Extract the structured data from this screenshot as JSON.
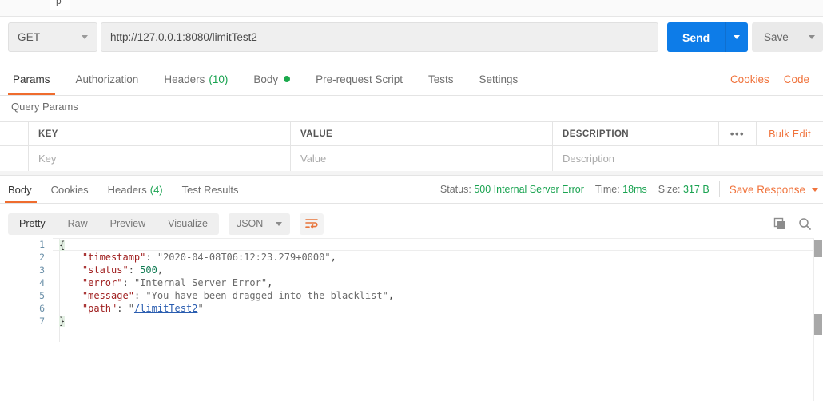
{
  "tabstrip": {
    "partial_tab_label": "p",
    "caret_icon": "chevron-down-icon"
  },
  "request": {
    "method": "GET",
    "url": "http://127.0.0.1:8080/limitTest2",
    "send_label": "Send",
    "save_label": "Save",
    "tabs": [
      {
        "label": "Params",
        "active": true,
        "count": "",
        "dot": false
      },
      {
        "label": "Authorization",
        "active": false,
        "count": "",
        "dot": false
      },
      {
        "label": "Headers",
        "active": false,
        "count": "(10)",
        "dot": false
      },
      {
        "label": "Body",
        "active": false,
        "count": "",
        "dot": true
      },
      {
        "label": "Pre-request Script",
        "active": false,
        "count": "",
        "dot": false
      },
      {
        "label": "Tests",
        "active": false,
        "count": "",
        "dot": false
      },
      {
        "label": "Settings",
        "active": false,
        "count": "",
        "dot": false
      }
    ],
    "cookies_link": "Cookies",
    "code_link": "Code"
  },
  "query_params": {
    "title": "Query Params",
    "headers": {
      "key": "KEY",
      "value": "VALUE",
      "description": "DESCRIPTION"
    },
    "placeholders": {
      "key": "Key",
      "value": "Value",
      "description": "Description"
    },
    "more_dots": "•••",
    "bulk_edit": "Bulk Edit"
  },
  "response": {
    "tabs": [
      {
        "label": "Body",
        "active": true,
        "count": ""
      },
      {
        "label": "Cookies",
        "active": false,
        "count": ""
      },
      {
        "label": "Headers",
        "active": false,
        "count": "(4)"
      },
      {
        "label": "Test Results",
        "active": false,
        "count": ""
      }
    ],
    "status_label": "Status:",
    "status_value": "500 Internal Server Error",
    "time_label": "Time:",
    "time_value": "18ms",
    "size_label": "Size:",
    "size_value": "317 B",
    "save_response": "Save Response",
    "format_modes": [
      {
        "label": "Pretty",
        "active": true
      },
      {
        "label": "Raw",
        "active": false
      },
      {
        "label": "Preview",
        "active": false
      },
      {
        "label": "Visualize",
        "active": false
      }
    ],
    "language": "JSON",
    "wrap_icon": "word-wrap-icon",
    "copy_icon": "copy-icon",
    "search_icon": "search-icon"
  },
  "body": {
    "line_numbers": [
      "1",
      "2",
      "3",
      "4",
      "5",
      "6",
      "7"
    ],
    "json": {
      "timestamp": "2020-04-08T06:12:23.279+0000",
      "status": 500,
      "error": "Internal Server Error",
      "message": "You have been dragged into the blacklist",
      "path": "/limitTest2"
    },
    "keys": {
      "timestamp": "\"timestamp\"",
      "status": "\"status\"",
      "error": "\"error\"",
      "message": "\"message\"",
      "path": "\"path\""
    },
    "values": {
      "timestamp": "\"2020-04-08T06:12:23.279+0000\"",
      "status": "500",
      "error": "\"Internal Server Error\"",
      "message": "\"You have been dragged into the blacklist\"",
      "path": "/limitTest2"
    },
    "open_brace": "{",
    "close_brace": "}"
  },
  "colors": {
    "accent_orange": "#ef6c2e",
    "send_blue": "#0d7ce8",
    "status_green": "#1aa351",
    "json_key": "#a02020",
    "json_number": "#0f7a52",
    "json_link": "#2a5db0"
  }
}
